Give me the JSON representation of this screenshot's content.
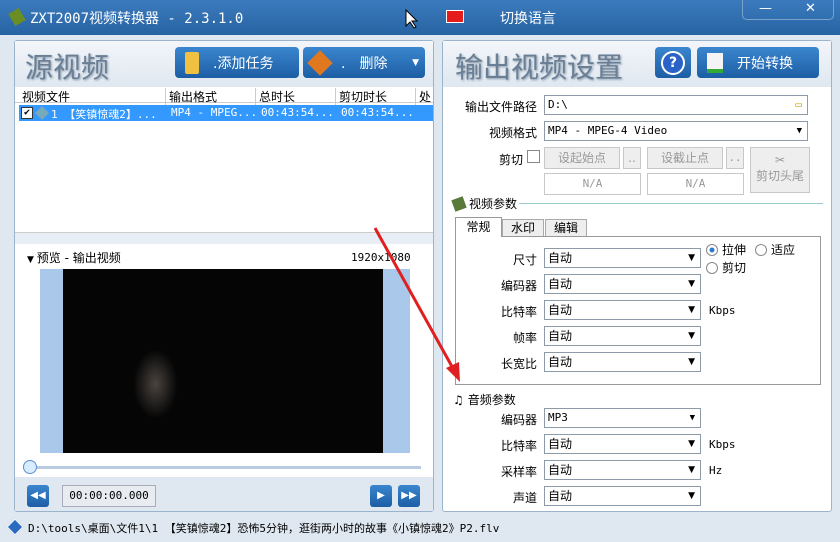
{
  "app": {
    "title": "ZXT2007视频转换器 - 2.3.1.0",
    "language_label": "切换语言",
    "minimize": "—",
    "close": "✕"
  },
  "source": {
    "title": "源视频",
    "add_task": ".添加任务",
    "delete": ".　删除",
    "columns": [
      "视频文件",
      "输出格式",
      "总时长",
      "剪切时长",
      "处"
    ],
    "rows": [
      {
        "checked": true,
        "file": "1 【笑镇惊魂2】...",
        "format": "MP4 - MPEG...",
        "total": "00:43:54...",
        "cut": "00:43:54..."
      }
    ],
    "preview_label": "预览 - 输出视频",
    "resolution": "1920x1080",
    "time": "00:00:00.000",
    "progress": 0
  },
  "output": {
    "title": "输出视频设置",
    "help": "?",
    "start": "开始转换",
    "path_label": "输出文件路径",
    "path": "D:\\",
    "format_label": "视频格式",
    "format": "MP4 - MPEG-4 Video",
    "cut_label": "剪切",
    "cut_checked": false,
    "set_start": "设起始点",
    "set_end": "设截止点",
    "dots": "..",
    "start_value": "N/A",
    "end_value": "N/A",
    "trim": "剪切头尾",
    "video_params": "视频参数",
    "tabs": [
      "常规",
      "水印",
      "编辑"
    ],
    "active_tab": 0,
    "video_rows": [
      {
        "label": "尺寸",
        "value": "自动"
      },
      {
        "label": "编码器",
        "value": "自动"
      },
      {
        "label": "比特率",
        "value": "自动",
        "unit": "Kbps"
      },
      {
        "label": "帧率",
        "value": "自动"
      },
      {
        "label": "长宽比",
        "value": "自动"
      }
    ],
    "scale_options": [
      "拉伸",
      "适应",
      "剪切"
    ],
    "scale_selected": "拉伸",
    "audio_params": "音频参数",
    "audio_rows": [
      {
        "label": "编码器",
        "value": "MP3"
      },
      {
        "label": "比特率",
        "value": "自动",
        "unit": "Kbps"
      },
      {
        "label": "采样率",
        "value": "自动",
        "unit": "Hz"
      },
      {
        "label": "声道",
        "value": "自动"
      }
    ]
  },
  "status": {
    "text": "D:\\tools\\桌面\\文件1\\1 【笑镇惊魂2】恐怖5分钟，逛街两小时的故事《小镇惊魂2》P2.flv"
  }
}
